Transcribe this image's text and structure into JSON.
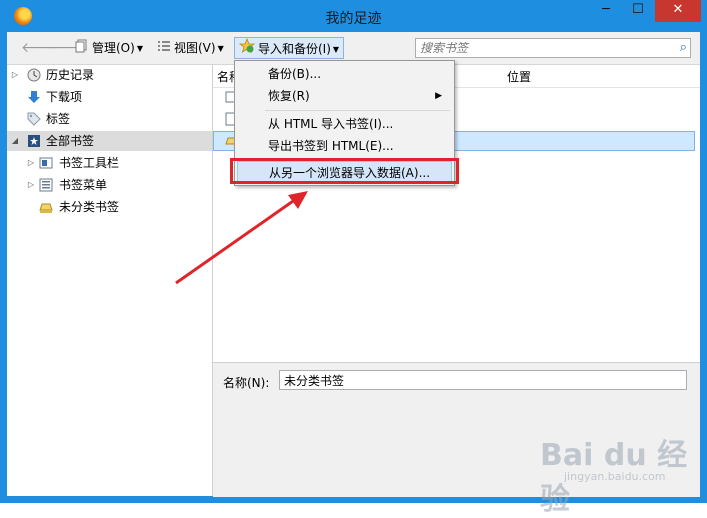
{
  "window": {
    "title": "我的足迹",
    "minimize": "─",
    "maximize": "☐",
    "close": "✕"
  },
  "toolbar": {
    "back": "🡐",
    "forward": "🡒",
    "organize": "管理(O)",
    "views": "视图(V)",
    "import_backup": "导入和备份(I)",
    "search_placeholder": "搜索书签",
    "search_icon": "⌕"
  },
  "sidebar": {
    "items": [
      {
        "label": "历史记录",
        "icon": "history-clock-icon"
      },
      {
        "label": "下载项",
        "icon": "download-arrow-icon"
      },
      {
        "label": "标签",
        "icon": "tag-icon"
      },
      {
        "label": "全部书签",
        "icon": "all-bookmarks-icon"
      },
      {
        "label": "书签工具栏",
        "icon": "bookmarks-toolbar-icon"
      },
      {
        "label": "书签菜单",
        "icon": "bookmarks-menu-icon"
      },
      {
        "label": "未分类书签",
        "icon": "unsorted-bookmarks-icon"
      }
    ]
  },
  "main": {
    "columns": {
      "name": "名称",
      "location": "位置"
    },
    "details": {
      "name_label": "名称(N):",
      "name_value": "未分类书签"
    }
  },
  "import_menu": {
    "items": [
      {
        "label": "备份(B)..."
      },
      {
        "label": "恢复(R)"
      },
      {
        "label": "从 HTML 导入书签(I)..."
      },
      {
        "label": "导出书签到 HTML(E)..."
      },
      {
        "label": "从另一个浏览器导入数据(A)..."
      }
    ]
  },
  "colors": {
    "titlebar": "#1e8fe0",
    "close": "#c7372f",
    "annotation": "#e0252a",
    "selection": "#cde8ff"
  },
  "watermark": {
    "logo": "Bai du 经验",
    "url": "jingyan.baidu.com"
  }
}
